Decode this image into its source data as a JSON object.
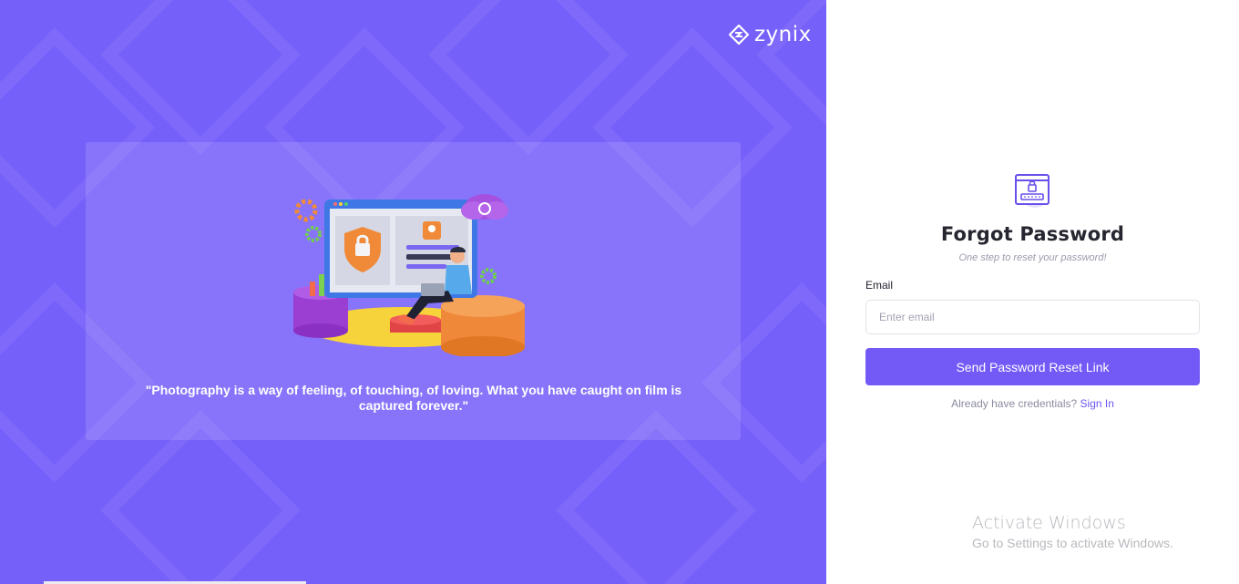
{
  "brand": {
    "name": "zynix"
  },
  "hero": {
    "quote": "\"Photography is a way of feeling, of touching, of loving. What you have caught on film is captured forever.\""
  },
  "form": {
    "title": "Forgot Password",
    "subtitle": "One step to reset your password!",
    "email_label": "Email",
    "email_placeholder": "Enter email",
    "email_value": "",
    "submit_label": "Send Password Reset Link",
    "signin_prompt": "Already have credentials?",
    "signin_link": "Sign In"
  },
  "watermark": {
    "title": "Activate Windows",
    "subtitle": "Go to Settings to activate Windows."
  },
  "colors": {
    "panel": "#7660fa",
    "accent": "#7359f6",
    "link": "#6b56f0"
  },
  "icons": {
    "brand": "zynix-logo-icon",
    "form": "lock-browser-icon"
  }
}
